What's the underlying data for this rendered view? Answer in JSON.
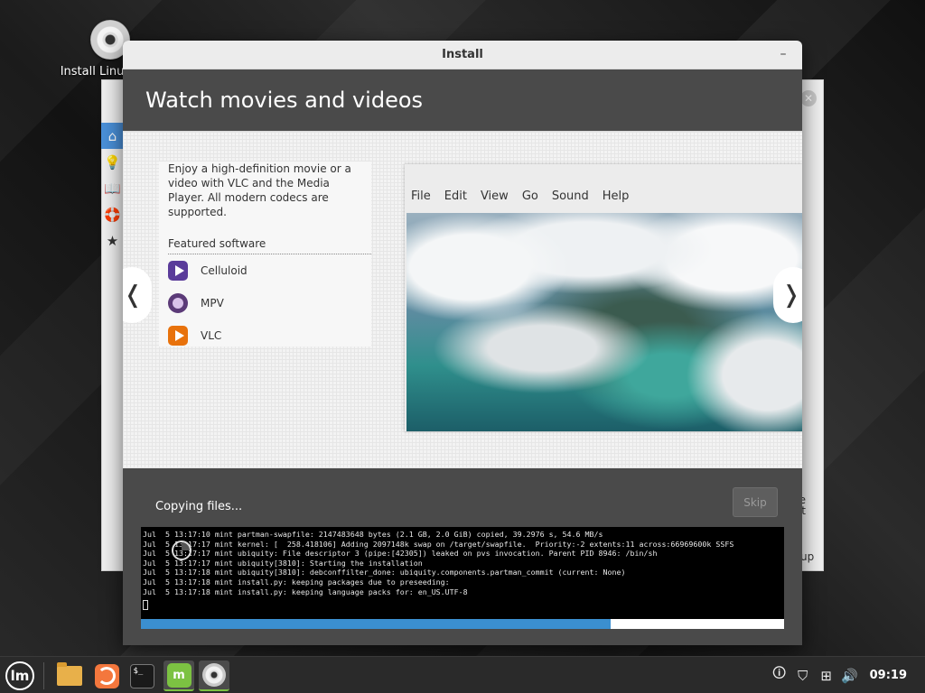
{
  "desktop": {
    "icon_label": "Install Linux Mint"
  },
  "background_window": {
    "close_glyph": "✕",
    "sidebar_icons": [
      "⌂",
      "💡",
      "📖",
      "🛟",
      "★"
    ],
    "right_text": "e\nt",
    "bottom_text": "up"
  },
  "installer": {
    "title": "Install",
    "minimize_glyph": "–",
    "slide": {
      "heading": "Watch movies and videos",
      "description": "Enjoy a high-definition movie or a video with VLC and the Media Player. All modern codecs are supported.",
      "featured_heading": "Featured software",
      "apps": [
        {
          "name": "Celluloid",
          "icon": "celluloid-icon"
        },
        {
          "name": "MPV",
          "icon": "mpv-icon"
        },
        {
          "name": "VLC",
          "icon": "vlc-icon"
        }
      ],
      "prev_glyph": "❬",
      "next_glyph": "❭",
      "player_menu": [
        "File",
        "Edit",
        "View",
        "Go",
        "Sound",
        "Help"
      ]
    },
    "progress": {
      "status": "Copying files...",
      "skip_label": "Skip",
      "fraction": 0.73,
      "log": [
        "Jul  5 13:17:10 mint partman-swapfile: 2147483648 bytes (2.1 GB, 2.0 GiB) copied, 39.2976 s, 54.6 MB/s",
        "Jul  5 13:17:17 mint kernel: [  258.418106] Adding 2097148k swap on /target/swapfile.  Priority:-2 extents:11 across:66969600k SSFS",
        "Jul  5 13:17:17 mint ubiquity: File descriptor 3 (pipe:[42305]) leaked on pvs invocation. Parent PID 8946: /bin/sh",
        "Jul  5 13:17:17 mint ubiquity[3810]: Starting the installation",
        "Jul  5 13:17:18 mint ubiquity[3810]: debconffilter_done: ubiquity.components.partman_commit (current: None)",
        "Jul  5 13:17:18 mint install.py: keeping packages due to preseeding:",
        "Jul  5 13:17:18 mint install.py: keeping language packs for: en_US.UTF-8"
      ]
    }
  },
  "taskbar": {
    "menu_glyph": "lm",
    "apps": [
      {
        "name": "files",
        "icon": "folder-icon",
        "active": false
      },
      {
        "name": "firefox",
        "icon": "firefox-icon",
        "active": false
      },
      {
        "name": "terminal",
        "icon": "terminal-icon",
        "active": false
      },
      {
        "name": "software-manager",
        "icon": "mint-install-icon",
        "active": true
      },
      {
        "name": "installer",
        "icon": "disc-icon",
        "active": true
      }
    ],
    "terminal_glyph": "$_",
    "mintinstall_glyph": "m",
    "tray_icons": [
      "update-manager-icon",
      "shield-icon",
      "network-icon",
      "volume-icon"
    ],
    "tray_glyphs": [
      "🛈",
      "⛉",
      "⊞",
      "🔊"
    ],
    "clock": "09:19"
  },
  "colors": {
    "progress_fill": "#3b8fd0",
    "mint_green": "#7cc242"
  }
}
